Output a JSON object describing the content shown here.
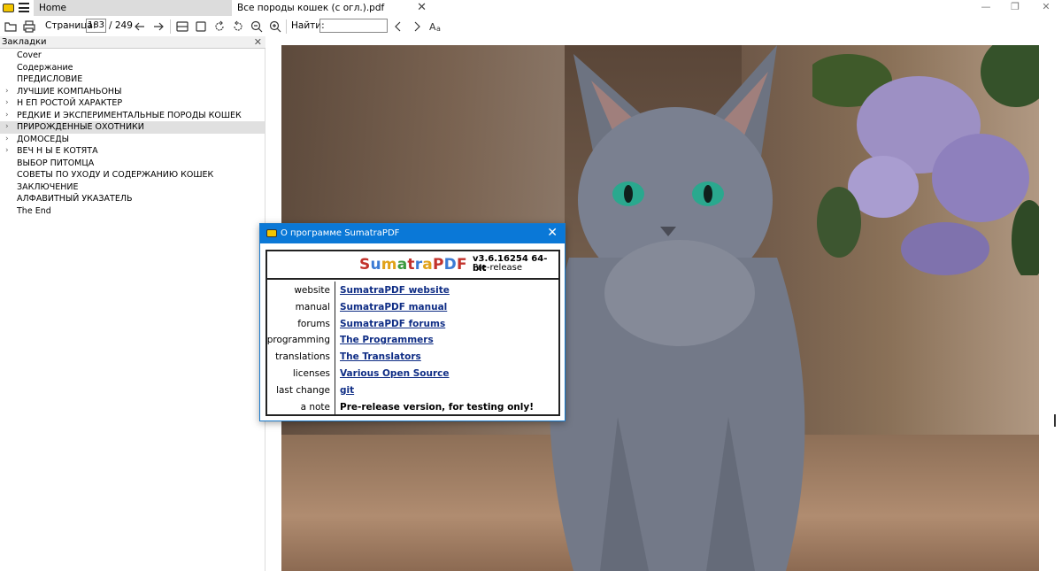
{
  "tabs": [
    {
      "label": "Home"
    },
    {
      "label": "Все породы кошек (с огл.).pdf"
    }
  ],
  "window_controls": {
    "minimize": "—",
    "maximize": "❐",
    "close": "✕"
  },
  "toolbar": {
    "page_label": "Страница:",
    "page_current": "183",
    "page_total": "/ 249",
    "find_label": "Найти:",
    "find_value": ""
  },
  "sidebar": {
    "title": "Закладки",
    "bookmarks": [
      {
        "label": "Cover",
        "expandable": false
      },
      {
        "label": "Содержание",
        "expandable": false
      },
      {
        "label": "ПРЕДИСЛОВИЕ",
        "expandable": false
      },
      {
        "label": "ЛУЧШИЕ КОМПАНЬОНЫ",
        "expandable": true
      },
      {
        "label": "Н ЕП РОСТОЙ ХАРАКТЕР",
        "expandable": true
      },
      {
        "label": "РЕДКИЕ И ЭКСПЕРИМЕНТАЛЬНЫЕ ПОРОДЫ КОШЕК",
        "expandable": true
      },
      {
        "label": "ПРИРОЖДЕННЫЕ ОХОТНИКИ",
        "expandable": true,
        "selected": true
      },
      {
        "label": "ДОМОСЕДЫ",
        "expandable": true
      },
      {
        "label": "ВЕЧ Н Ы Е КОТЯТА",
        "expandable": true
      },
      {
        "label": "ВЫБОР ПИТОМЦА",
        "expandable": false
      },
      {
        "label": "СОВЕТЫ ПО УХОДУ И СОДЕРЖАНИЮ КОШЕК",
        "expandable": false
      },
      {
        "label": "ЗАКЛЮЧЕНИЕ",
        "expandable": false
      },
      {
        "label": "АЛФАВИТНЫЙ УКАЗАТЕЛЬ",
        "expandable": false
      },
      {
        "label": "The End",
        "expandable": false
      }
    ]
  },
  "about": {
    "title": "О программе SumatraPDF",
    "brand_letters": [
      {
        "ch": "S",
        "color": "#c2322b"
      },
      {
        "ch": "u",
        "color": "#3b7bd4"
      },
      {
        "ch": "m",
        "color": "#e0a21a"
      },
      {
        "ch": "a",
        "color": "#3c9a3f"
      },
      {
        "ch": "t",
        "color": "#c2322b"
      },
      {
        "ch": "r",
        "color": "#3b7bd4"
      },
      {
        "ch": "a",
        "color": "#e0a21a"
      },
      {
        "ch": "P",
        "color": "#c2322b"
      },
      {
        "ch": "D",
        "color": "#3b7bd4"
      },
      {
        "ch": "F",
        "color": "#c2322b"
      }
    ],
    "version": "v3.6.16254 64-bit",
    "prerelease": "Pre-release",
    "rows": [
      {
        "label": "website",
        "value": "SumatraPDF website",
        "link": true
      },
      {
        "label": "manual",
        "value": "SumatraPDF manual",
        "link": true
      },
      {
        "label": "forums",
        "value": "SumatraPDF forums",
        "link": true
      },
      {
        "label": "programming",
        "value": "The Programmers",
        "link": true
      },
      {
        "label": "translations",
        "value": "The Translators",
        "link": true
      },
      {
        "label": "licenses",
        "value": "Various Open Source",
        "link": true
      },
      {
        "label": "last change",
        "value": "git",
        "link": true
      },
      {
        "label": "a note",
        "value": "Pre-release version, for testing only!",
        "link": false
      }
    ]
  },
  "colors": {
    "dialog_title": "#0a78d7",
    "link": "#0f2d85"
  }
}
